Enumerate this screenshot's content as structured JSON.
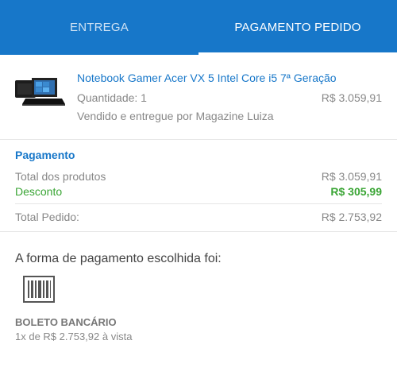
{
  "tabs": {
    "entrega": "ENTREGA",
    "pagamento": "PAGAMENTO PEDIDO"
  },
  "product": {
    "name": "Notebook Gamer Acer VX 5 Intel Core i5 7ª Geração",
    "quantity": "Quantidade: 1",
    "price": "R$ 3.059,91",
    "seller": "Vendido e entregue por Magazine Luiza",
    "image_icon": "laptop-image"
  },
  "payment": {
    "title": "Pagamento",
    "total_products_label": "Total dos produtos",
    "total_products_value": "R$ 3.059,91",
    "discount_label": "Desconto",
    "discount_value": "R$ 305,99",
    "total_order_label": "Total Pedido:",
    "total_order_value": "R$ 2.753,92"
  },
  "method": {
    "title": "A forma de pagamento escolhida foi:",
    "icon": "barcode-icon",
    "name": "BOLETO BANCÁRIO",
    "description": "1x de R$ 2.753,92 à vista"
  },
  "colors": {
    "accent": "#1777c9",
    "discount": "#3aa535"
  }
}
